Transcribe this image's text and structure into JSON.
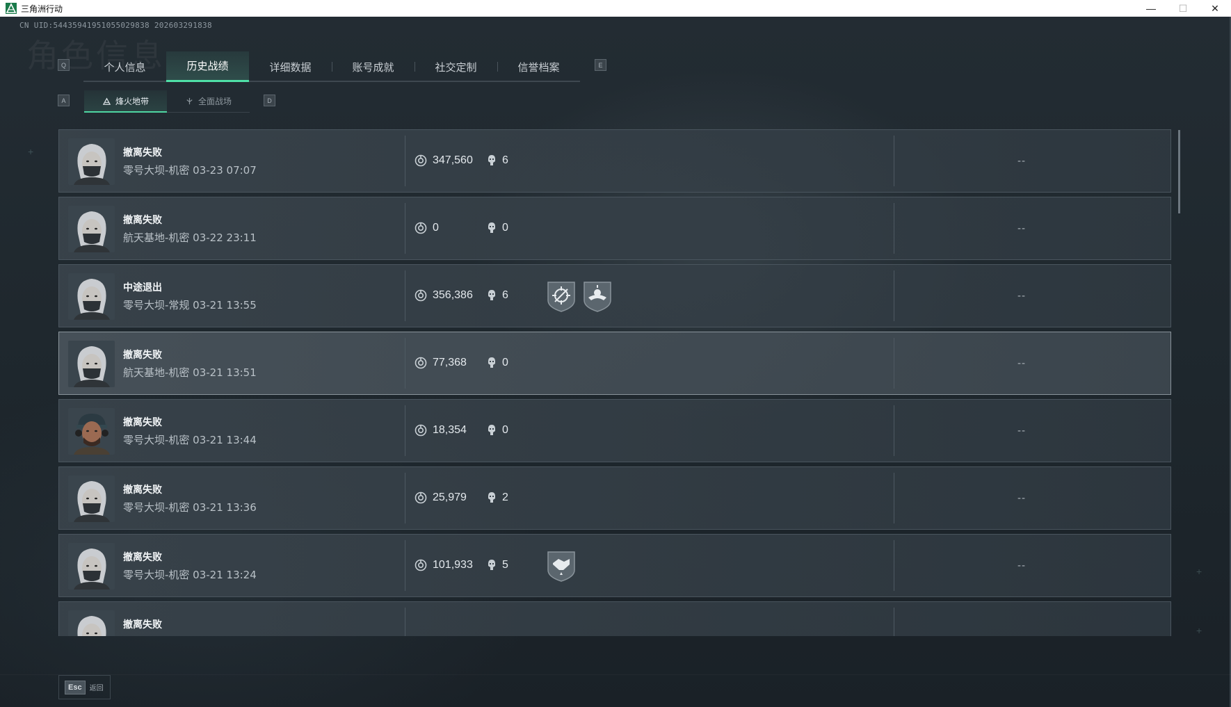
{
  "window": {
    "title": "三角洲行动",
    "minimize": "—",
    "maximize": "☐",
    "close": "✕"
  },
  "header": {
    "uid": "CN UID:54435941951055029838 202603291838",
    "bg_title": "角色信息"
  },
  "main_tabs": {
    "key_left": "Q",
    "key_right": "E",
    "items": [
      {
        "label": "个人信息"
      },
      {
        "label": "历史战绩"
      },
      {
        "label": "详细数据"
      },
      {
        "label": "账号成就"
      },
      {
        "label": "社交定制"
      },
      {
        "label": "信誉档案"
      }
    ],
    "active_index": 1
  },
  "sub_tabs": {
    "key_left": "A",
    "key_right": "D",
    "items": [
      {
        "label": "烽火地带",
        "icon": "beacon-icon"
      },
      {
        "label": "全面战场",
        "icon": "battlefield-icon"
      }
    ],
    "active_index": 0
  },
  "records": [
    {
      "status": "撤离失败",
      "detail": "零号大坝-机密 03-23 07:07",
      "value": "347,560",
      "kills": "6",
      "rating": "--",
      "avatar": "female-operator",
      "badges": []
    },
    {
      "status": "撤离失败",
      "detail": "航天基地-机密 03-22 23:11",
      "value": "0",
      "kills": "0",
      "rating": "--",
      "avatar": "female-operator",
      "badges": []
    },
    {
      "status": "中途退出",
      "detail": "零号大坝-常规 03-21 13:55",
      "value": "356,386",
      "kills": "6",
      "rating": "--",
      "avatar": "female-operator",
      "badges": [
        "crosshair-badge",
        "eagle-badge"
      ]
    },
    {
      "status": "撤离失败",
      "detail": "航天基地-机密 03-21 13:51",
      "value": "77,368",
      "kills": "0",
      "rating": "--",
      "avatar": "female-operator",
      "badges": []
    },
    {
      "status": "撤离失败",
      "detail": "零号大坝-机密 03-21 13:44",
      "value": "18,354",
      "kills": "0",
      "rating": "--",
      "avatar": "male-operator",
      "badges": []
    },
    {
      "status": "撤离失败",
      "detail": "零号大坝-机密 03-21 13:36",
      "value": "25,979",
      "kills": "2",
      "rating": "--",
      "avatar": "female-operator",
      "badges": []
    },
    {
      "status": "撤离失败",
      "detail": "零号大坝-机密 03-21 13:24",
      "value": "101,933",
      "kills": "5",
      "rating": "--",
      "avatar": "female-operator",
      "badges": [
        "handshake-badge"
      ]
    },
    {
      "status": "撤离失败",
      "detail": "",
      "value": "",
      "kills": "",
      "rating": "",
      "avatar": "female-operator",
      "badges": []
    }
  ],
  "highlighted_index": 3,
  "footer": {
    "esc_key": "Esc",
    "esc_label": "返回"
  },
  "colors": {
    "accent": "#4fe0a8",
    "row_bg": "#3a444c",
    "text": "#d9dfe4"
  }
}
